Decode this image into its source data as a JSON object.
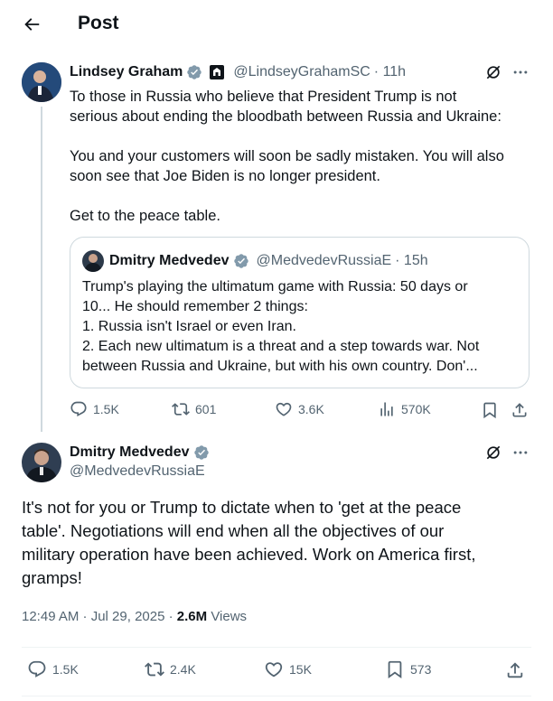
{
  "header": {
    "title": "Post"
  },
  "original_post": {
    "author_name": "Lindsey Graham",
    "author_handle": "@LindseyGrahamSC",
    "time": "· 11h",
    "text_line1": "To those in Russia who believe that President Trump is not",
    "text_line2": "serious about ending the bloodbath between Russia and Ukraine:",
    "text_line3": "You and your customers will soon be sadly mistaken. You will also",
    "text_line4": "soon see that Joe Biden is no longer president.",
    "text_line5": "Get to the peace table.",
    "stats": {
      "replies": "1.5K",
      "reposts": "601",
      "likes": "3.6K",
      "views": "570K"
    }
  },
  "quoted_post": {
    "author_name": "Dmitry Medvedev",
    "author_handle": "@MedvedevRussiaE",
    "time": "· 15h",
    "text_line1": "Trump's playing the ultimatum game with Russia: 50 days or",
    "text_line2": "10... He should remember 2 things:",
    "text_line3": "1. Russia isn't Israel or even Iran.",
    "text_line4": "2. Each new ultimatum is a threat and a step towards war. Not",
    "text_line5": "between Russia and Ukraine, but with his own country. Don'..."
  },
  "main_post": {
    "author_name": "Dmitry Medvedev",
    "author_handle": "@MedvedevRussiaE",
    "text_line1": "It's not for you or Trump to dictate when to 'get at the peace",
    "text_line2": "table'. Negotiations will end when all the objectives of our",
    "text_line3": "military operation have been achieved. Work on America first,",
    "text_line4": "gramps!",
    "timestamp": "12:49 AM · Jul 29, 2025",
    "views_count": "2.6M",
    "views_label": "Views",
    "stats": {
      "replies": "1.5K",
      "reposts": "2.4K",
      "likes": "15K",
      "bookmarks": "573"
    }
  },
  "colors": {
    "text": "#0f1419",
    "muted": "#536471",
    "verified": "#829aab",
    "border": "#cfd9de"
  },
  "icons": [
    "back-arrow-icon",
    "verified-badge-icon",
    "government-icon",
    "grok-icon",
    "more-icon",
    "reply-icon",
    "repost-icon",
    "like-icon",
    "views-icon",
    "bookmark-icon",
    "share-icon"
  ]
}
